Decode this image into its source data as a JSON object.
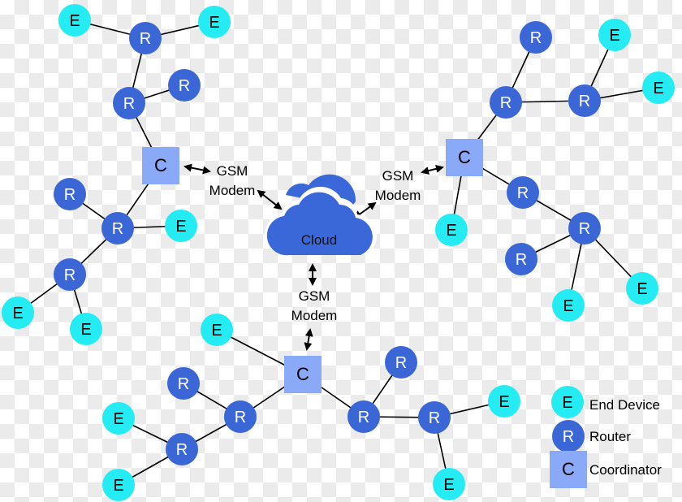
{
  "colors": {
    "router": "#3a66d6",
    "end_device": "#25ecf2",
    "coordinator": "#8aaaf7",
    "cloud": "#3b68d9",
    "edge": "#000000"
  },
  "labels": {
    "end_device": "E",
    "router": "R",
    "coordinator": "C"
  },
  "cloud": {
    "label": "Cloud"
  },
  "modems": [
    {
      "line1": "GSM",
      "line2": "Modem"
    },
    {
      "line1": "GSM",
      "line2": "Modem"
    },
    {
      "line1": "GSM",
      "line2": "Modem"
    }
  ],
  "legend": [
    {
      "symbol": "E",
      "type": "end_device",
      "label": "End Device"
    },
    {
      "symbol": "R",
      "type": "router",
      "label": "Router"
    },
    {
      "symbol": "C",
      "type": "coordinator",
      "label": "Coordinator"
    }
  ]
}
